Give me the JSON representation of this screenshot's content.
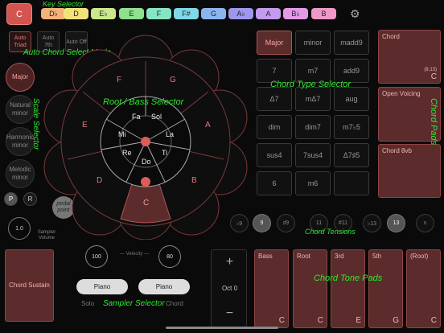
{
  "key_selector": {
    "annotation": "Key Selector",
    "keys": [
      {
        "label": "C",
        "color": "#d4554f"
      },
      {
        "label": "D♭",
        "color": "#f3b27a"
      },
      {
        "label": "D",
        "color": "#f1e27a"
      },
      {
        "label": "E♭",
        "color": "#cbe98c"
      },
      {
        "label": "E",
        "color": "#8fe08f"
      },
      {
        "label": "F",
        "color": "#86e6c4"
      },
      {
        "label": "F#",
        "color": "#7fd8e8"
      },
      {
        "label": "G",
        "color": "#8ab6ef"
      },
      {
        "label": "A♭",
        "color": "#9e97ef"
      },
      {
        "label": "A",
        "color": "#c39bef"
      },
      {
        "label": "B♭",
        "color": "#e49ae8"
      },
      {
        "label": "B",
        "color": "#ee99c7"
      }
    ],
    "settings_icon": "gear-icon"
  },
  "auto_chord": {
    "annotation": "Auto Chord Select Mode",
    "buttons": [
      "Auto Triad",
      "Auto 7th",
      "Auto Off"
    ]
  },
  "scale_selector": {
    "annotation": "Scale Selector",
    "scales": [
      "Major",
      "Natural minor",
      "Harmonic minor",
      "Melodic minor"
    ],
    "p_label": "P",
    "r_label": "R",
    "pedal_point": "pedal point",
    "volume_value": "1.0",
    "volume_label": "Sampler Volume"
  },
  "root_selector": {
    "annotation": "Root / Bass Selector",
    "outer_notes": [
      "F",
      "G",
      "A",
      "B",
      "C",
      "D",
      "E"
    ],
    "solfege": [
      "Fa",
      "Sol",
      "La",
      "Ti",
      "Do",
      "Re",
      "Mi"
    ]
  },
  "chord_type": {
    "annotation": "Chord Type Selector",
    "types": [
      "Major",
      "minor",
      "madd9",
      "7",
      "m7",
      "add9",
      "Δ7",
      "mΔ7",
      "aug",
      "dim",
      "dim7",
      "m7♭5",
      "sus4",
      "7sus4",
      "Δ7♯5",
      "6",
      "m6",
      ""
    ],
    "selected": "Major"
  },
  "chord_pads": {
    "annotation": "Chord Pads",
    "pads": [
      {
        "title": "Chord",
        "sub": "(9,13)",
        "note": "C"
      },
      {
        "title": "Open Voicing",
        "sub": "",
        "note": ""
      },
      {
        "title": "Chord 8vb",
        "sub": "",
        "note": ""
      }
    ]
  },
  "tensions": {
    "annotation": "Chord Tensions",
    "items": [
      "♭9",
      "9",
      "♯9",
      "11",
      "#11",
      "♭13",
      "13",
      "x"
    ],
    "selected": [
      "9",
      "13"
    ]
  },
  "chord_sustain": "Chord Sustain",
  "velocity": {
    "label": "Velocity",
    "left": "100",
    "right": "80"
  },
  "sampler": {
    "annotation": "Sampler Selector",
    "solo_label": "Solo",
    "chord_label": "Chord",
    "solo_instrument": "Piano",
    "chord_instrument": "Piano"
  },
  "octave": {
    "plus": "+",
    "value": "Oct 0",
    "minus": "−"
  },
  "tone_pads": {
    "annotation": "Chord Tone Pads",
    "pads": [
      {
        "label": "Bass",
        "note": "C"
      },
      {
        "label": "Root",
        "note": "C"
      },
      {
        "label": "3rd",
        "note": "E"
      },
      {
        "label": "5th",
        "note": "G"
      },
      {
        "label": "(Root)",
        "note": "C"
      }
    ]
  }
}
